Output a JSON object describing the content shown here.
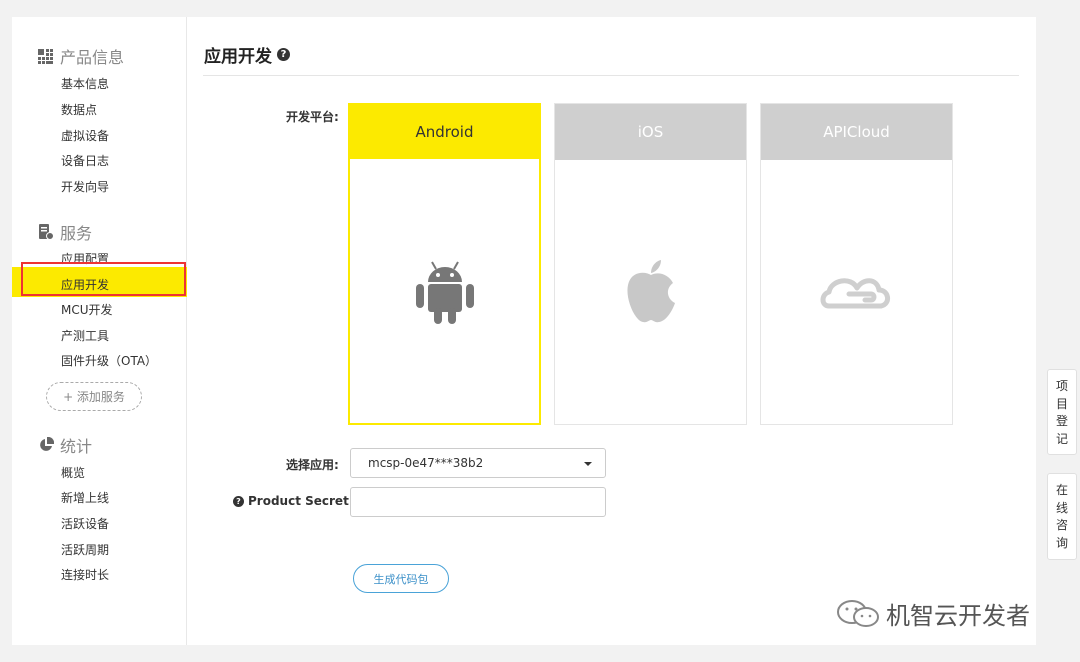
{
  "sidebar": {
    "product_title": "产品信息",
    "product_items": [
      "基本信息",
      "数据点",
      "虚拟设备",
      "设备日志",
      "开发向导"
    ],
    "service_title": "服务",
    "service_items": [
      "应用配置",
      "应用开发",
      "MCU开发",
      "产测工具",
      "固件升级（OTA）"
    ],
    "add_service": "+ 添加服务",
    "stats_title": "统计",
    "stats_items": [
      "概览",
      "新增上线",
      "活跃设备",
      "活跃周期",
      "连接时长"
    ],
    "active_item": "应用开发"
  },
  "main": {
    "title": "应用开发",
    "help_glyph": "?",
    "platform_label": "开发平台:",
    "platforms": [
      {
        "name": "Android",
        "icon": "android-icon",
        "selected": true
      },
      {
        "name": "iOS",
        "icon": "apple-icon",
        "selected": false
      },
      {
        "name": "APICloud",
        "icon": "apicloud-icon",
        "selected": false
      }
    ],
    "select_app_label": "选择应用:",
    "select_app_value": "mcsp-0e47***38b2",
    "product_secret_label": "Product Secret:",
    "product_secret_value": "",
    "generate_button": "生成代码包"
  },
  "right_tabs": {
    "project_register": [
      "项",
      "目",
      "登",
      "记"
    ],
    "online_consult": [
      "在",
      "线",
      "咨",
      "询"
    ]
  },
  "watermark": {
    "text": "机智云开发者"
  },
  "colors": {
    "accent_yellow": "#fcea00",
    "inactive_card": "#cfcfcf",
    "button_blue": "#3a8fc8",
    "highlight_red": "#e33"
  }
}
